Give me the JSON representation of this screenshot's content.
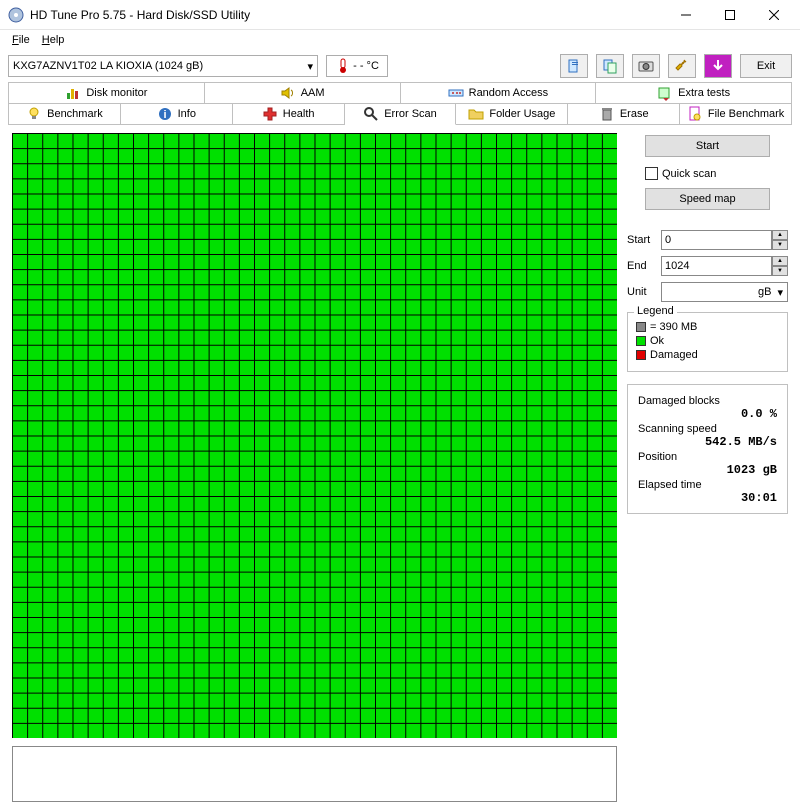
{
  "title": "HD Tune Pro 5.75 - Hard Disk/SSD Utility",
  "menu": {
    "file": "File",
    "help": "Help"
  },
  "drive": "KXG7AZNV1T02 LA KIOXIA (1024 gB)",
  "temp": "- - °C",
  "exit": "Exit",
  "tabs1": {
    "disk_monitor": "Disk monitor",
    "aam": "AAM",
    "random_access": "Random Access",
    "extra_tests": "Extra tests"
  },
  "tabs2": {
    "benchmark": "Benchmark",
    "info": "Info",
    "health": "Health",
    "error_scan": "Error Scan",
    "folder_usage": "Folder Usage",
    "erase": "Erase",
    "file_benchmark": "File Benchmark"
  },
  "side": {
    "start": "Start",
    "quick_scan": "Quick scan",
    "speed_map": "Speed map",
    "start_label": "Start",
    "end_label": "End",
    "unit_label": "Unit",
    "start_val": "0",
    "end_val": "1024",
    "unit_val": "gB"
  },
  "legend": {
    "title": "Legend",
    "block_size": "= 390 MB",
    "ok": "Ok",
    "damaged": "Damaged"
  },
  "stats": {
    "damaged_blocks_label": "Damaged blocks",
    "damaged_blocks_value": "0.0 %",
    "scanning_speed_label": "Scanning speed",
    "scanning_speed_value": "542.5 MB/s",
    "position_label": "Position",
    "position_value": "1023 gB",
    "elapsed_label": "Elapsed time",
    "elapsed_value": "30:01"
  }
}
